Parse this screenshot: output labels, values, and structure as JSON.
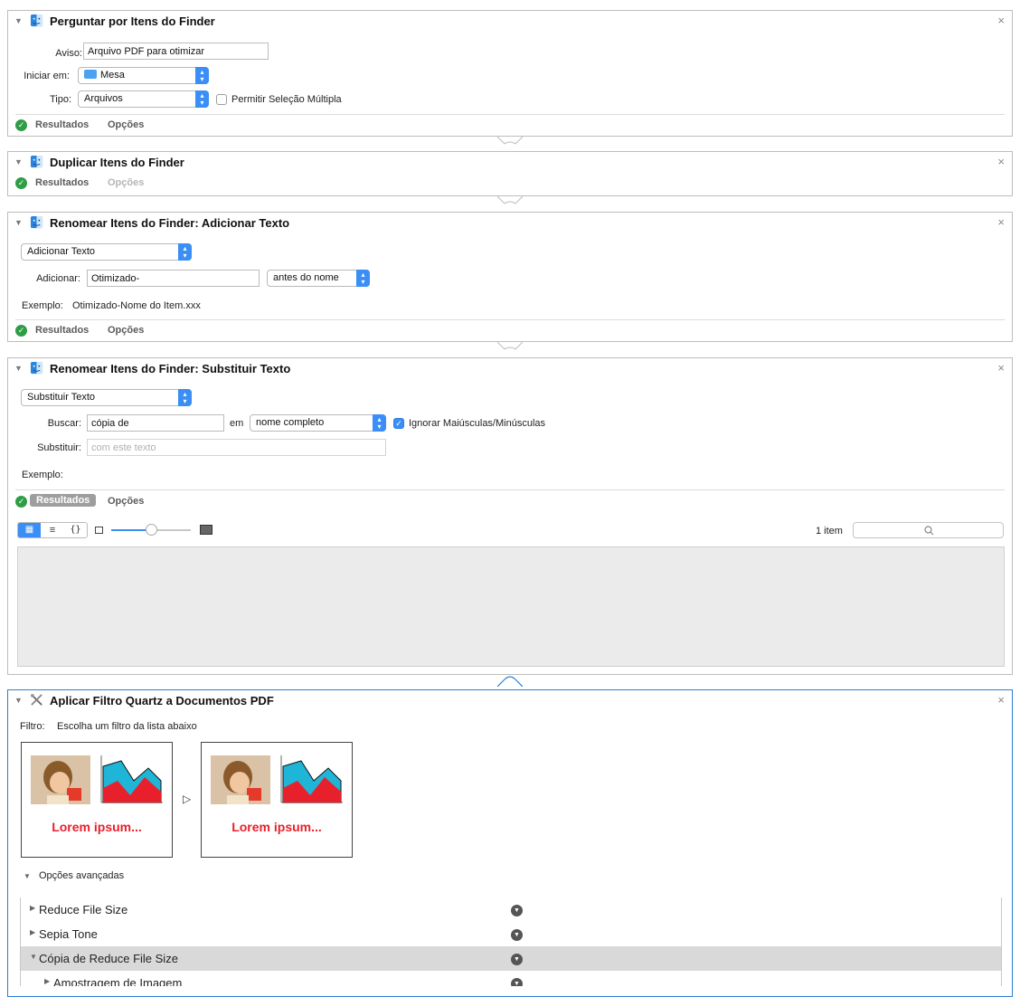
{
  "actions": {
    "ask_finder": {
      "title": "Perguntar por Itens do Finder",
      "aviso_label": "Aviso:",
      "aviso_value": "Arquivo PDF para otimizar",
      "iniciar_label": "Iniciar em:",
      "iniciar_value": "Mesa",
      "tipo_label": "Tipo:",
      "tipo_value": "Arquivos",
      "multi_label": "Permitir Seleção Múltipla",
      "multi_checked": false,
      "results_label": "Resultados",
      "options_label": "Opções"
    },
    "duplicate": {
      "title": "Duplicar Itens do Finder",
      "results_label": "Resultados",
      "options_label": "Opções"
    },
    "rename_add": {
      "title": "Renomear Itens do Finder: Adicionar Texto",
      "mode_value": "Adicionar Texto",
      "add_label": "Adicionar:",
      "add_value": "Otimizado-",
      "position_value": "antes do nome",
      "example_label": "Exemplo:",
      "example_value": "Otimizado-Nome do Item.xxx",
      "results_label": "Resultados",
      "options_label": "Opções"
    },
    "rename_replace": {
      "title": "Renomear Itens do Finder: Substituir Texto",
      "mode_value": "Substituir Texto",
      "find_label": "Buscar:",
      "find_value": "cópia de",
      "in_label": "em",
      "in_value": "nome completo",
      "ignore_case_label": "Ignorar Maiúsculas/Minúsculas",
      "ignore_case_checked": true,
      "replace_label": "Substituir:",
      "replace_placeholder": "com este texto",
      "example_label": "Exemplo:",
      "results_label": "Resultados",
      "options_label": "Opções",
      "item_count": "1 item"
    },
    "quartz": {
      "title": "Aplicar Filtro Quartz a Documentos PDF",
      "filter_label": "Filtro:",
      "filter_hint": "Escolha um filtro da lista abaixo",
      "preview_text": "Lorem ipsum...",
      "advanced_label": "Opções avançadas",
      "filters": [
        {
          "name": "Reduce File Size",
          "expanded": false
        },
        {
          "name": "Sepia Tone",
          "expanded": false
        },
        {
          "name": "Cópia de Reduce File Size",
          "expanded": true
        },
        {
          "name": "Amostragem de Imagem",
          "expanded": false
        }
      ]
    }
  },
  "colors": {
    "accent": "#3a8ef6",
    "selected_border": "#2b7fd1",
    "success": "#2e9d45",
    "lorem_red": "#e8202b"
  },
  "icons": {
    "finder": "finder-icon",
    "quartz": "tools-icon",
    "ok": "checkmark-circle-icon",
    "close": "close-icon"
  }
}
